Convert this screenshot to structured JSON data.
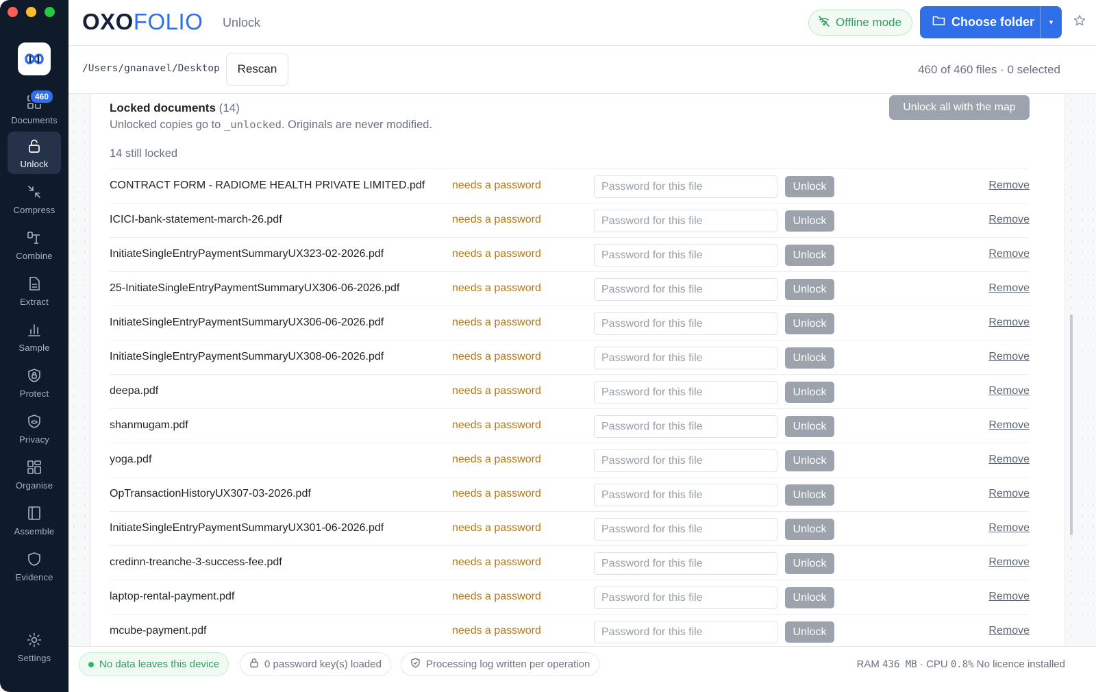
{
  "app": {
    "brand_part1": "OXO",
    "brand_part2": "FOLIO",
    "subtitle": "Unlock"
  },
  "header": {
    "offline_label": "Offline mode",
    "choose_folder_label": "Choose folder",
    "caret": "▾"
  },
  "sidebar": {
    "items": [
      {
        "label": "Documents",
        "icon": "grid-icon",
        "badge": "460"
      },
      {
        "label": "Unlock",
        "icon": "unlock-icon",
        "active": true
      },
      {
        "label": "Compress",
        "icon": "compress-icon"
      },
      {
        "label": "Combine",
        "icon": "combine-icon"
      },
      {
        "label": "Extract",
        "icon": "extract-icon"
      },
      {
        "label": "Sample",
        "icon": "bar-chart-icon"
      },
      {
        "label": "Protect",
        "icon": "lock-shield-icon"
      },
      {
        "label": "Privacy",
        "icon": "shield-eye-icon"
      },
      {
        "label": "Organise",
        "icon": "organise-icon"
      },
      {
        "label": "Assemble",
        "icon": "assemble-icon"
      },
      {
        "label": "Evidence",
        "icon": "shield-icon"
      },
      {
        "label": "Settings",
        "icon": "gear-icon"
      }
    ]
  },
  "toolbar": {
    "path": "/Users/gnanavel/Desktop",
    "rescan_label": "Rescan",
    "file_count": "460 of 460 files · 0 selected"
  },
  "locked": {
    "title": "Locked documents",
    "count": "(14)",
    "desc_prefix": "Unlocked copies go to ",
    "desc_code": "_unlocked",
    "desc_suffix": ". Originals are never modified.",
    "unlock_all_label": "Unlock all with the map",
    "still_locked": "14 still locked",
    "status_text": "needs a password",
    "password_placeholder": "Password for this file",
    "unlock_label": "Unlock",
    "remove_label": "Remove",
    "files": [
      "CONTRACT FORM - RADIOME HEALTH PRIVATE LIMITED.pdf",
      "ICICI-bank-statement-march-26.pdf",
      "InitiateSingleEntryPaymentSummaryUX323-02-2026.pdf",
      "25-InitiateSingleEntryPaymentSummaryUX306-06-2026.pdf",
      "InitiateSingleEntryPaymentSummaryUX306-06-2026.pdf",
      "InitiateSingleEntryPaymentSummaryUX308-06-2026.pdf",
      "deepa.pdf",
      "shanmugam.pdf",
      "yoga.pdf",
      "OpTransactionHistoryUX307-03-2026.pdf",
      "InitiateSingleEntryPaymentSummaryUX301-06-2026.pdf",
      "credinn-treanche-3-success-fee.pdf",
      "laptop-rental-payment.pdf",
      "mcube-payment.pdf"
    ]
  },
  "footer": {
    "privacy_label": "No data leaves this device",
    "keys_label": "0 password key(s) loaded",
    "log_label": "Processing log written per operation",
    "ram_label": "RAM",
    "ram_value": "436 MB",
    "sep": "·",
    "cpu_label": "CPU",
    "cpu_value": "0.8%",
    "licence": "No licence installed"
  },
  "colors": {
    "accent": "#2f6fea",
    "sidebar_bg": "#0f1a2a",
    "status_warning": "#b5791a",
    "success": "#2f9e5b"
  }
}
